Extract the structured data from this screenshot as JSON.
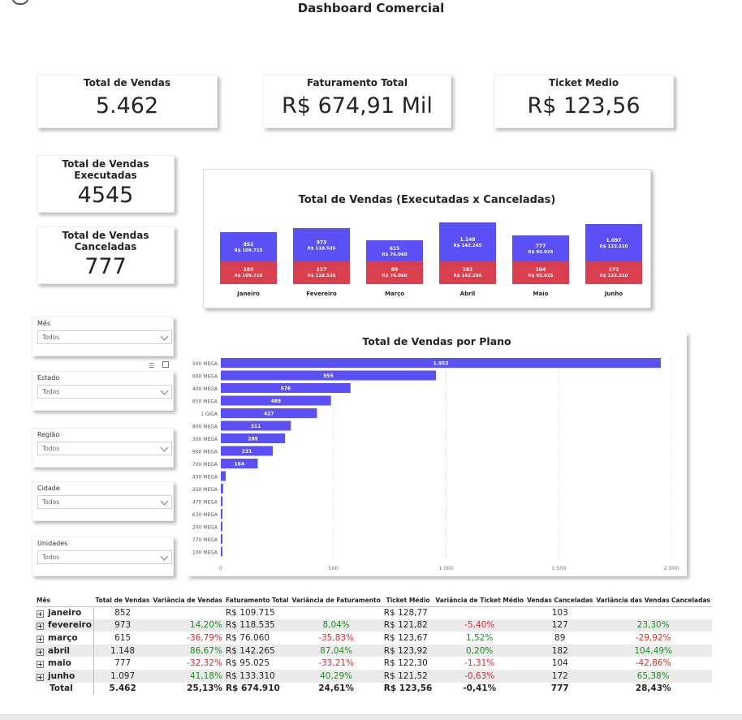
{
  "title": "Dashboard Comercial",
  "kpis": {
    "total_vendas": {
      "label": "Total de Vendas",
      "value": "5.462"
    },
    "faturamento": {
      "label": "Faturamento Total",
      "value": "R$ 674,91 Mil"
    },
    "ticket": {
      "label": "Ticket Medio",
      "value": "R$ 123,56"
    },
    "executadas": {
      "label_line1": "Total de Vendas",
      "label_line2": "Executadas",
      "value": "4545"
    },
    "canceladas": {
      "label_line1": "Total de Vendas",
      "label_line2": "Canceladas",
      "value": "777"
    }
  },
  "filters": [
    {
      "label": "Mês",
      "value": "Todos"
    },
    {
      "label": "Estado",
      "value": "Todos"
    },
    {
      "label": "Região",
      "value": "Todos"
    },
    {
      "label": "Cidade",
      "value": "Todos"
    },
    {
      "label": "Unidades",
      "value": "Todos"
    }
  ],
  "colors": {
    "executadas": "#5b50f5",
    "canceladas": "#d9404f",
    "plano": "#5b50f5",
    "positive": "#1e8f1e",
    "negative": "#d42b2b"
  },
  "chart_data": [
    {
      "type": "bar",
      "title": "Total de Vendas (Executadas x Canceladas)",
      "categories": [
        "Janeiro",
        "Fevereiro",
        "Março",
        "Abril",
        "Maio",
        "Junho"
      ],
      "series": [
        {
          "values": [
            852,
            973,
            615,
            1148,
            777,
            1097
          ],
          "labels": [
            "852",
            "973",
            "615",
            "1.148",
            "777",
            "1.097"
          ],
          "sub_labels": [
            "R$ 109.715",
            "R$ 118.535",
            "R$ 76.060",
            "R$ 142.265",
            "R$ 95.025",
            "R$ 133.310"
          ]
        },
        {
          "values": [
            103,
            127,
            89,
            182,
            104,
            172
          ],
          "labels": [
            "103",
            "127",
            "89",
            "182",
            "104",
            "172"
          ],
          "sub_labels": [
            "R$ 109.715",
            "R$ 118.535",
            "R$ 76.060",
            "R$ 142.265",
            "R$ 95.025",
            "R$ 133.310"
          ]
        }
      ],
      "stacked": true
    },
    {
      "type": "bar",
      "orientation": "horizontal",
      "title": "Total de Vendas por Plano",
      "categories": [
        "500 MEGA",
        "600 MEGA",
        "400 MEGA",
        "650 MEGA",
        "1 GIGA",
        "800 MEGA",
        "300 MEGA",
        "900 MEGA",
        "700 MEGA",
        "450 MEGA",
        "250 MEGA",
        "470 MEGA",
        "630 MEGA",
        "200 MEGA",
        "770 MEGA",
        "100 MEGA"
      ],
      "values": [
        1953,
        955,
        576,
        489,
        427,
        311,
        285,
        231,
        164,
        22,
        10,
        8,
        7,
        6,
        5,
        4
      ],
      "labels": [
        "1.953",
        "955",
        "576",
        "489",
        "427",
        "311",
        "285",
        "231",
        "164",
        "",
        "",
        "",
        "",
        "",
        "",
        ""
      ],
      "xlim": [
        0,
        2000
      ],
      "xticks": [
        {
          "v": 0,
          "label": "0"
        },
        {
          "v": 500,
          "label": "500"
        },
        {
          "v": 1000,
          "label": "1.000"
        },
        {
          "v": 1500,
          "label": "1.500"
        },
        {
          "v": 2000,
          "label": "2.000"
        }
      ],
      "grid": true
    }
  ],
  "table": {
    "headers": [
      "Mês",
      "Total de Vendas",
      "Variância de Vendas",
      "Faturamento Total",
      "Variância de Faturamento",
      "Ticket Médio",
      "Variância de Ticket Médio",
      "Vendas Canceladas",
      "Variância das Vendas Canceladas"
    ],
    "rows": [
      {
        "mes": "janeiro",
        "vendas": "852",
        "var_vendas": "",
        "fat": "R$ 109.715",
        "var_fat": "",
        "ticket": "R$ 128,77",
        "var_ticket": "",
        "canc": "103",
        "var_canc": ""
      },
      {
        "mes": "fevereiro",
        "vendas": "973",
        "var_vendas": "14,20%",
        "fat": "R$ 118.535",
        "var_fat": "8,04%",
        "ticket": "R$ 121,82",
        "var_ticket": "-5,40%",
        "canc": "127",
        "var_canc": "23,30%"
      },
      {
        "mes": "março",
        "vendas": "615",
        "var_vendas": "-36,79%",
        "fat": "R$ 76.060",
        "var_fat": "-35,83%",
        "ticket": "R$ 123,67",
        "var_ticket": "1,52%",
        "canc": "89",
        "var_canc": "-29,92%"
      },
      {
        "mes": "abril",
        "vendas": "1.148",
        "var_vendas": "86,67%",
        "fat": "R$ 142.265",
        "var_fat": "87,04%",
        "ticket": "R$ 123,92",
        "var_ticket": "0,20%",
        "canc": "182",
        "var_canc": "104,49%"
      },
      {
        "mes": "maio",
        "vendas": "777",
        "var_vendas": "-32,32%",
        "fat": "R$ 95.025",
        "var_fat": "-33,21%",
        "ticket": "R$ 122,30",
        "var_ticket": "-1,31%",
        "canc": "104",
        "var_canc": "-42,86%"
      },
      {
        "mes": "junho",
        "vendas": "1.097",
        "var_vendas": "41,18%",
        "fat": "R$ 133.310",
        "var_fat": "40,29%",
        "ticket": "R$ 121,52",
        "var_ticket": "-0,63%",
        "canc": "172",
        "var_canc": "65,38%"
      }
    ],
    "total": {
      "mes": "Total",
      "vendas": "5.462",
      "var_vendas": "25,13%",
      "fat": "R$ 674.910",
      "var_fat": "24,61%",
      "ticket": "R$ 123,56",
      "var_ticket": "-0,41%",
      "canc": "777",
      "var_canc": "28,43%"
    }
  }
}
